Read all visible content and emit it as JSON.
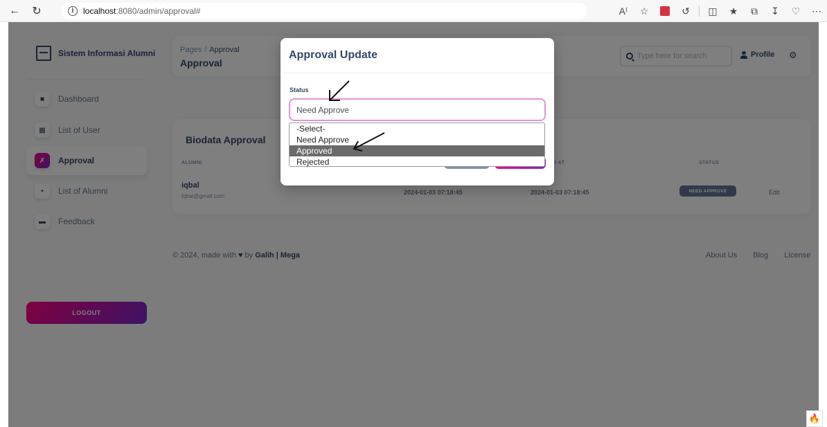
{
  "browser": {
    "url_host": "localhost",
    "url_path": ":8080/admin/approval#",
    "icons": [
      "back-arrow-icon",
      "reload-icon",
      "info-icon",
      "read-aloud-icon",
      "star-icon",
      "extension-icon",
      "refresh-icon",
      "split-screen-icon",
      "favorites-icon",
      "collections-icon",
      "downloads-icon",
      "performance-icon",
      "more-icon"
    ]
  },
  "sidebar": {
    "brand": "Sistem Informasi Alumni",
    "items": [
      {
        "label": "Dashboard",
        "icon": "shop-icon",
        "active": false
      },
      {
        "label": "List of User",
        "icon": "users-icon",
        "active": false
      },
      {
        "label": "Approval",
        "icon": "tools-icon",
        "active": true
      },
      {
        "label": "List of Alumni",
        "icon": "alumni-icon",
        "active": false
      },
      {
        "label": "Feedback",
        "icon": "card-icon",
        "active": false
      }
    ],
    "logout": "LOGOUT"
  },
  "navbar": {
    "breadcrumb_root": "Pages",
    "breadcrumb_sep": "/",
    "breadcrumb_current": "Approval",
    "title": "Approval",
    "search_placeholder": "Type here for search",
    "profile": "Profile"
  },
  "card": {
    "title": "Biodata Approval",
    "headers": [
      "ALUMNI",
      "D AT",
      "STATUS"
    ],
    "row": {
      "name": "iqbal",
      "email": "Iqbal@gmail.com",
      "created": "2024-01-03 07:18:45",
      "updated": "2024-01-03 07:18:45",
      "status": "NEED APPROVE",
      "action": "Edit"
    }
  },
  "footer": {
    "copyright_pre": "© 2024, made with",
    "copyright_by": "by",
    "authors": "Galih | Mega",
    "links": [
      "About Us",
      "Blog",
      "License"
    ]
  },
  "modal": {
    "title": "Approval Update",
    "field_label": "Status",
    "selected_value": "Need Approve",
    "options": [
      "-Select-",
      "Need Approve",
      "Approved",
      "Rejected"
    ],
    "highlighted_option": "Approved"
  },
  "colors": {
    "accent_gradient_start": "#7928ca",
    "accent_gradient_end": "#ff0080",
    "text_primary": "#344767",
    "status_badge": "#627594",
    "select_border": "#e293d3"
  }
}
